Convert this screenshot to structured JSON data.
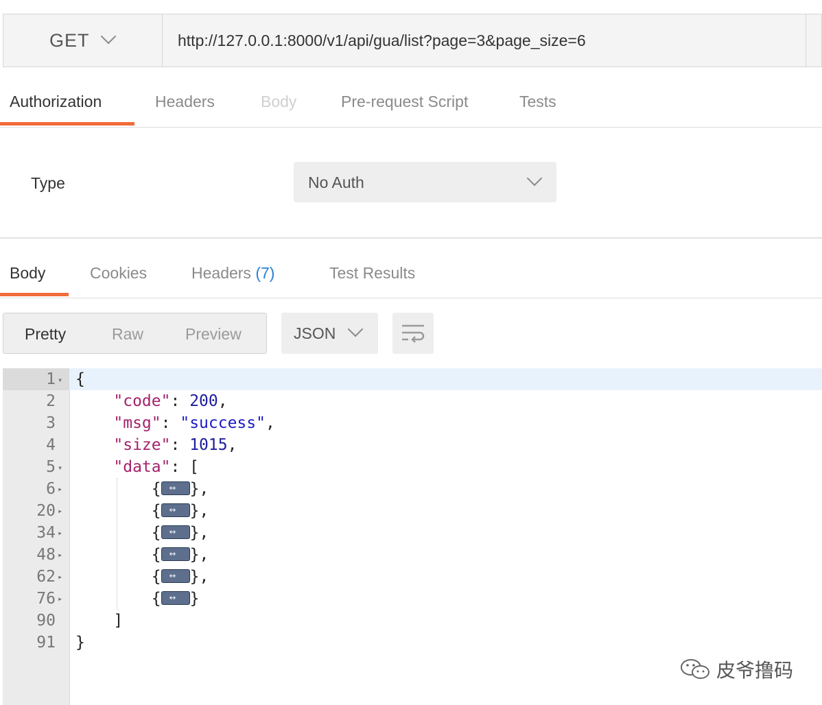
{
  "request": {
    "method": "GET",
    "url": "http://127.0.0.1:8000/v1/api/gua/list?page=3&page_size=6"
  },
  "request_tabs": [
    "Authorization",
    "Headers",
    "Body",
    "Pre-request Script",
    "Tests"
  ],
  "auth": {
    "type_label": "Type",
    "type_value": "No Auth"
  },
  "response_tabs": {
    "body": "Body",
    "cookies": "Cookies",
    "headers": "Headers",
    "headers_count": "(7)",
    "tests": "Test Results"
  },
  "view_modes": [
    "Pretty",
    "Raw",
    "Preview"
  ],
  "format": "JSON",
  "editor": {
    "line_numbers": [
      "1",
      "2",
      "3",
      "4",
      "5",
      "6",
      "20",
      "34",
      "48",
      "62",
      "76",
      "90",
      "91"
    ],
    "code": {
      "code_key": "\"code\"",
      "code_val": "200",
      "msg_key": "\"msg\"",
      "msg_val": "\"success\"",
      "size_key": "\"size\"",
      "size_val": "1015",
      "data_key": "\"data\""
    }
  },
  "watermark": "皮爷撸码",
  "colors": {
    "accent": "#f26b3a",
    "count": "#2a7fd4",
    "key": "#a3226b",
    "number": "#1d1d9e",
    "string": "#1b1bc4"
  }
}
